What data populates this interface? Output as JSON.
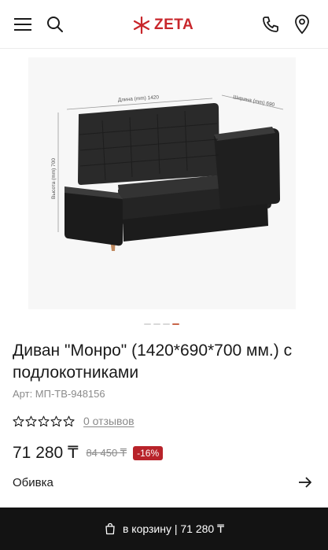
{
  "header": {
    "menu_icon": "hamburger-menu-icon",
    "search_icon": "search-icon",
    "logo_text": "ZETA",
    "logo_color": "#c8262b",
    "phone_icon": "phone-icon",
    "location_icon": "map-pin-icon"
  },
  "gallery": {
    "image_description_labels": {
      "length": "Длина (mm) 1420",
      "width": "Ширина (mm) 690",
      "height": "Высота (mm) 700"
    },
    "slides_count": 4,
    "active_slide": 4
  },
  "product": {
    "title": "Диван \"Монро\" (1420*690*700 мм.) с подлокотниками",
    "sku": "Арт: МП-ТВ-948156",
    "rating_stars": 0,
    "reviews_label": "0 отзывов",
    "price": "71 280 ₸",
    "old_price": "84 450 ₸",
    "discount": "-16%",
    "option_label": "Обивка"
  },
  "cart": {
    "label": "в корзину | 71 280 ₸",
    "icon": "shopping-bag-icon"
  },
  "colors": {
    "accent": "#c8262b",
    "discount_bg": "#b8232a",
    "cart_bar": "#131313"
  }
}
